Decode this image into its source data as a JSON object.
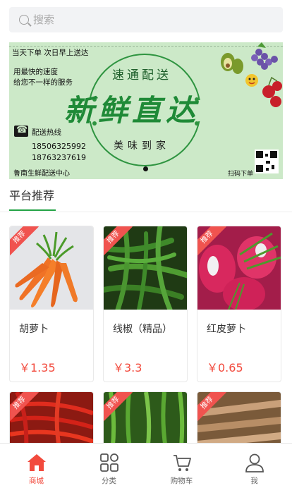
{
  "search": {
    "placeholder": "搜索"
  },
  "banner": {
    "top_left": "当天下单 次日早上送达",
    "slogan_line1": "用最快的速度",
    "slogan_line2": "给您不一样的服务",
    "ring_top": "速通配送",
    "headline": "新鲜直达",
    "ring_bottom": "美味到家",
    "hotline_label": "配送热线",
    "phone1": "18506325992",
    "phone2": "18763237619",
    "center_name": "鲁南生鲜配送中心",
    "scan_label": "扫码下单"
  },
  "section": {
    "title": "平台推荐"
  },
  "badge_label": "推荐",
  "products": [
    {
      "name": "胡萝卜",
      "price": "￥1.35"
    },
    {
      "name": "线椒（精品）",
      "price": "￥3.3"
    },
    {
      "name": "红皮萝卜",
      "price": "￥0.65"
    },
    {
      "name": "",
      "price": ""
    },
    {
      "name": "",
      "price": ""
    },
    {
      "name": "",
      "price": ""
    }
  ],
  "tabs": [
    {
      "label": "商城",
      "icon": "home-icon",
      "active": true
    },
    {
      "label": "分类",
      "icon": "category-icon",
      "active": false
    },
    {
      "label": "购物车",
      "icon": "cart-icon",
      "active": false
    },
    {
      "label": "我",
      "icon": "user-icon",
      "active": false
    }
  ],
  "colors": {
    "accent_green": "#23a345",
    "price_red": "#f24a3d",
    "badge_red": "#f0534f",
    "banner_bg": "#cce9c8"
  }
}
